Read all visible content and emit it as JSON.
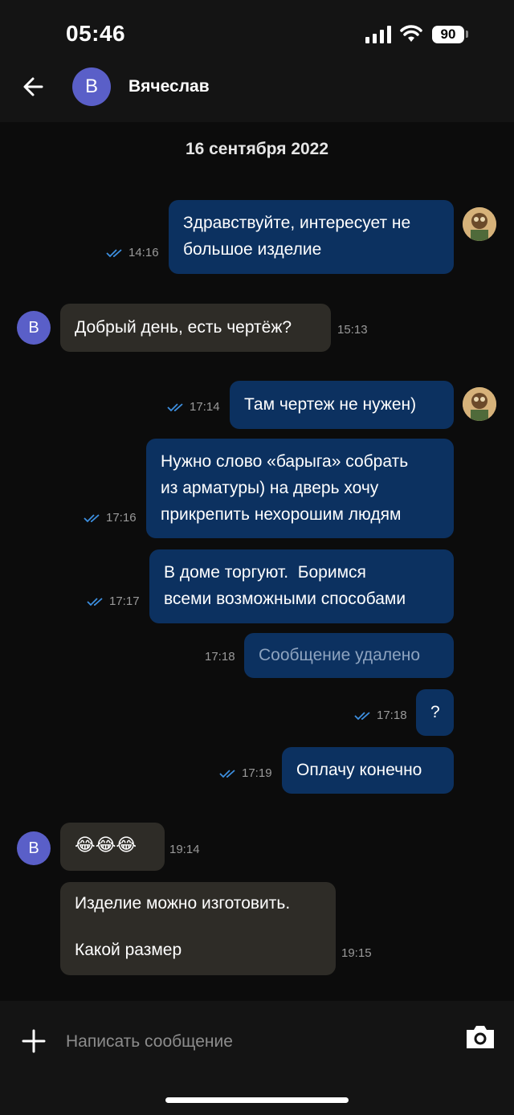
{
  "status_bar": {
    "time": "05:46",
    "battery": "90"
  },
  "header": {
    "avatar_letter": "В",
    "contact_name": "Вячеслав"
  },
  "chat": {
    "date": "16 сентября 2022",
    "messages": [
      {
        "dir": "out",
        "lines": [
          "Здравствуйте, интересует не",
          "большое изделие"
        ],
        "time": "14:16",
        "read": true
      },
      {
        "dir": "in",
        "lines": [
          "Добрый день, есть чертёж?"
        ],
        "time": "15:13"
      },
      {
        "dir": "out",
        "lines": [
          "Там чертеж не нужен)"
        ],
        "time": "17:14",
        "read": true
      },
      {
        "dir": "out",
        "lines": [
          "Нужно слово «барыга» собрать",
          "из арматуры) на дверь хочу",
          "прикрепить нехорошим людям"
        ],
        "time": "17:16",
        "read": true
      },
      {
        "dir": "out",
        "lines": [
          "В доме торгуют.  Боримся",
          "всеми возможными способами"
        ],
        "time": "17:17",
        "read": true
      },
      {
        "dir": "out",
        "lines": [
          "Сообщение удалено"
        ],
        "time": "17:18",
        "deleted": true
      },
      {
        "dir": "out",
        "lines": [
          "?"
        ],
        "time": "17:18",
        "read": true
      },
      {
        "dir": "out",
        "lines": [
          "Оплачу конечно"
        ],
        "time": "17:19",
        "read": true
      },
      {
        "dir": "in",
        "lines": [
          "😂😂😂"
        ],
        "time": "19:14"
      },
      {
        "dir": "in",
        "lines": [
          "Изделие можно изготовить.",
          "",
          "Какой размер"
        ],
        "time": "19:15"
      }
    ]
  },
  "composer": {
    "placeholder": "Написать сообщение"
  },
  "colors": {
    "outgoing_bubble": "#0c3160",
    "incoming_bubble": "#2e2c27",
    "avatar": "#5a5fc8",
    "read_check": "#3d8fe0"
  }
}
